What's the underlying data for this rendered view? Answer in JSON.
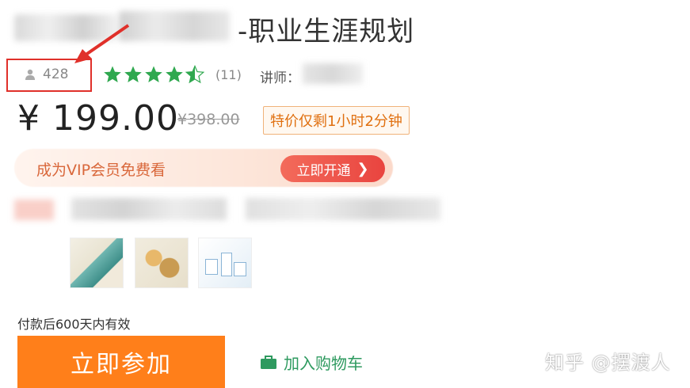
{
  "course": {
    "title_suffix": "-职业生涯规划",
    "students": "428",
    "rating_stars": 4.5,
    "rating_count": "(11)",
    "teacher_label": "讲师："
  },
  "pricing": {
    "price": "¥ 199.00",
    "original_price": "¥398.00",
    "countdown": "特价仅剩1小时2分钟"
  },
  "vip": {
    "text": "成为VIP会员免费看",
    "button_label": "立即开通"
  },
  "purchase": {
    "validity": "付款后600天内有效",
    "join_label": "立即参加",
    "cart_label": "加入购物车"
  },
  "watermark": "知乎 @摆渡人",
  "colors": {
    "star": "#2fa84f",
    "annotation": "#e0302a",
    "join_button": "#ff7f1a",
    "vip_button": "#e9443f",
    "cart": "#2e9a5f"
  }
}
